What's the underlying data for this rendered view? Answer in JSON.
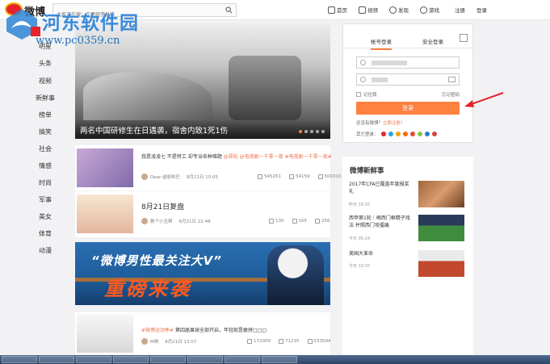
{
  "topbar": {
    "logo_text": "微博",
    "search_placeholder": "大家正在搜：王思聪李易峰",
    "nav": [
      {
        "label": "首页",
        "icon": "home-icon"
      },
      {
        "label": "视频",
        "icon": "video-icon"
      },
      {
        "label": "发现",
        "icon": "discover-icon"
      },
      {
        "label": "游戏",
        "icon": "game-icon"
      },
      {
        "label": "注册",
        "icon": ""
      },
      {
        "label": "登录",
        "icon": ""
      }
    ]
  },
  "watermark": {
    "title": "河东软件园",
    "url": "www.pc0359.cn"
  },
  "leftnav": [
    "明星",
    "头条",
    "视频",
    "新鲜事",
    "榜单",
    "搞笑",
    "社会",
    "情感",
    "时尚",
    "军事",
    "美女",
    "体育",
    "动漫"
  ],
  "banner": {
    "caption": "两名中国研修生在日遇袭，宿舍内致1死1伤",
    "slides": 5,
    "active_slide": 1
  },
  "feed": [
    {
      "tag": "",
      "title": "我是凌凌七 不是特工 却专治各种难题",
      "title_tags": "@郑屹 @电视剧一千零一夜 #电视剧一千零一夜#",
      "author": "Dear-迪丽热巴",
      "time": "8月21日 10:05",
      "reposts": "545261",
      "comments": "54159",
      "likes": "500310"
    },
    {
      "tag": "",
      "title": "8月21日复盘",
      "title_tags": "",
      "author": "数个小丑帮",
      "time": "8月21日 22:48",
      "reposts": "130",
      "comments": "165",
      "likes": "256"
    },
    {
      "tag": "#微博运动季#",
      "title": "第四届果球全部开启，年轻就是敢拼□□□",
      "title_tags": "",
      "author": "M闸",
      "time": "8月21日 13:07",
      "reposts": "172009",
      "comments": "71235",
      "likes": "533594"
    }
  ],
  "ad": {
    "line1": "“微博男性最关注大V”",
    "line2": "重磅来袭"
  },
  "login": {
    "tab_account": "帐号登录",
    "tab_secure": "安全登录",
    "remember": "记住我",
    "forgot": "忘记密码",
    "button": "登录",
    "register_prompt": "还没有微博？",
    "register_link": "立即注册！",
    "other_label": "其它登录：",
    "other_colors": [
      "#e5232b",
      "#2aa1e4",
      "#f0a30a",
      "#ff6b00",
      "#e14b3b",
      "#8cc34a",
      "#2b7bd4",
      "#d9453b"
    ]
  },
  "news": {
    "heading": "微博新鲜事",
    "items": [
      {
        "title": "2017年CFA已覆盖年度报奖礼",
        "meta": "昨天 19:35"
      },
      {
        "title": "西甲第1轮｜梅西门框精子戏法 并照西门攻擂痛",
        "meta": "今天 05:24"
      },
      {
        "title": "美国大革命",
        "meta": "今天 10:35"
      }
    ]
  },
  "colors": {
    "accent": "#ff8140",
    "link": "#eb7350",
    "brand_red": "#e5232b"
  }
}
